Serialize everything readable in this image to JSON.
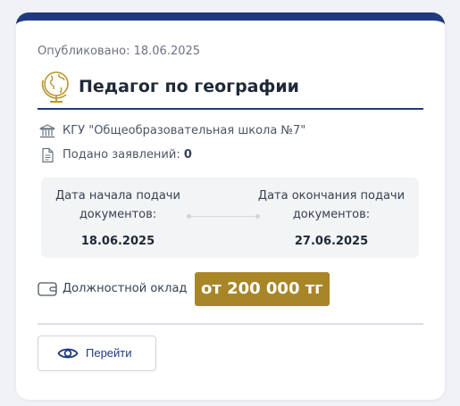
{
  "vacancy": {
    "published_label": "Опубликовано:",
    "published_date": "18.06.2025",
    "title": "Педагог по географии",
    "icon": "globe-icon",
    "organization": "КГУ \"Общеобразовательная школа №7\"",
    "applications_label": "Подано заявлений:",
    "applications_count": "0"
  },
  "dates": {
    "start_label": "Дата начала подачи документов:",
    "start_value": "18.06.2025",
    "end_label": "Дата окончания подачи документов:",
    "end_value": "27.06.2025"
  },
  "salary": {
    "label": "Должностной оклад",
    "value": "от 200 000 тг"
  },
  "actions": {
    "go_label": "Перейти"
  },
  "colors": {
    "accent": "#1e3a80",
    "salary_badge": "#a88627",
    "icon_gold": "#b8962e"
  }
}
